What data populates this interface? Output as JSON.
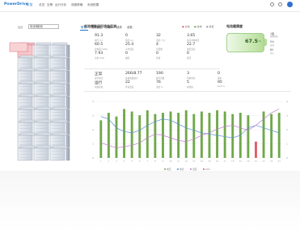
{
  "header": {
    "logo": "PowerDrive",
    "logo_tag": "导览",
    "nav": [
      "总览",
      "告警",
      "运行分析",
      "调度策略",
      "系统配置"
    ],
    "icons": [
      "bell-icon",
      "help-icon",
      "avatar"
    ]
  },
  "subbar": {
    "breadcrumb": "站点",
    "select_value": "电池储能柜",
    "tabs": [
      "概览",
      "历史数据",
      "告警",
      "趋势",
      "参数"
    ],
    "active_tab": 0
  },
  "status_panel": {
    "title": "电池储能运行状态监测",
    "legend": [
      "充电",
      "放电",
      "静置"
    ],
    "stats": [
      {
        "value": "91.3",
        "label": "电压 (V)"
      },
      {
        "value": "0",
        "label": "电流 (A)"
      },
      {
        "value": "32",
        "label": "温度 (°C)"
      },
      {
        "value": "3.65",
        "label": "最高单体电压"
      },
      {
        "value": "60.5",
        "label": "总电量 (kWh)"
      },
      {
        "value": "25.4",
        "label": "平均温度"
      },
      {
        "value": "4",
        "label": "告警数"
      },
      {
        "value": "22.7",
        "label": "最低温度"
      },
      {
        "value": "7.93",
        "label": "功率 (kW)"
      },
      {
        "value": "0",
        "label": "故障"
      },
      {
        "value": "0",
        "label": "离线"
      },
      {
        "value": "0",
        "label": "通讯"
      }
    ],
    "row2": [
      {
        "value": "正常",
        "label": "运行模式"
      },
      {
        "value": "266/8.77",
        "label": "充放电量统计"
      },
      {
        "value": "190",
        "label": "循环次数"
      },
      {
        "value": "3",
        "label": "均衡状态"
      },
      {
        "value": "0",
        "label": "保护"
      }
    ],
    "row3": [
      {
        "value": "运行",
        "label": "系统状态"
      },
      {
        "value": "22",
        "label": "环境温度"
      },
      {
        "value": "76",
        "label": "湿度 %"
      },
      {
        "value": "5",
        "label": "电池簇"
      },
      {
        "value": "95",
        "label": "SOH %"
      }
    ]
  },
  "soc_panel": {
    "title": "电池健康度",
    "value": "67.5",
    "unit": "%",
    "side": [
      {
        "value": "1级",
        "label": "健康等级"
      },
      {
        "value": "5%",
        "label": "衰减"
      },
      {
        "value": "85",
        "label": "评分"
      }
    ]
  },
  "chart_data": {
    "type": "bar",
    "categories": [
      "1",
      "2",
      "3",
      "4",
      "5",
      "6",
      "7",
      "8",
      "9",
      "10",
      "11",
      "12",
      "13",
      "14",
      "15",
      "16",
      "17",
      "18",
      "19",
      "20",
      "21",
      "22",
      "23",
      "24"
    ],
    "series": [
      {
        "values": [
          3.0,
          3.6,
          3.3,
          3.9,
          3.7,
          3.4,
          3.8,
          3.5,
          3.6,
          3.7,
          3.6,
          3.8,
          3.5,
          3.7,
          3.6,
          3.8,
          3.7,
          3.5,
          3.6,
          3.4,
          1.3,
          3.7,
          3.5,
          3.6
        ],
        "color": "#6fa84a"
      },
      {
        "values": [
          3.3,
          3.1,
          2.4,
          2.1,
          2.0,
          2.2,
          2.6,
          2.9,
          3.1,
          3.0,
          2.7,
          2.4,
          2.2,
          2.0,
          1.9,
          1.8,
          1.7,
          1.6,
          1.8,
          2.4,
          2.6,
          2.4,
          2.2,
          2.0
        ],
        "color": "#5b8fd6"
      },
      {
        "values": [
          1.2,
          1.0,
          0.8,
          0.9,
          1.0,
          1.2,
          1.6,
          1.9,
          1.8,
          1.6,
          1.4,
          1.3,
          1.5,
          1.8,
          2.0,
          2.3,
          2.5,
          2.6,
          2.4,
          2.2,
          2.6,
          3.1,
          3.6,
          3.9
        ],
        "color": "#c07bd2"
      }
    ],
    "highlight_index": 20,
    "highlight_color": "#e25b67",
    "ylim": [
      0,
      4.5
    ],
    "y_ticks": [
      "4",
      "3",
      "2",
      "1",
      "0"
    ],
    "legend": [
      "电压",
      "电流",
      "温度",
      "SOC"
    ]
  }
}
